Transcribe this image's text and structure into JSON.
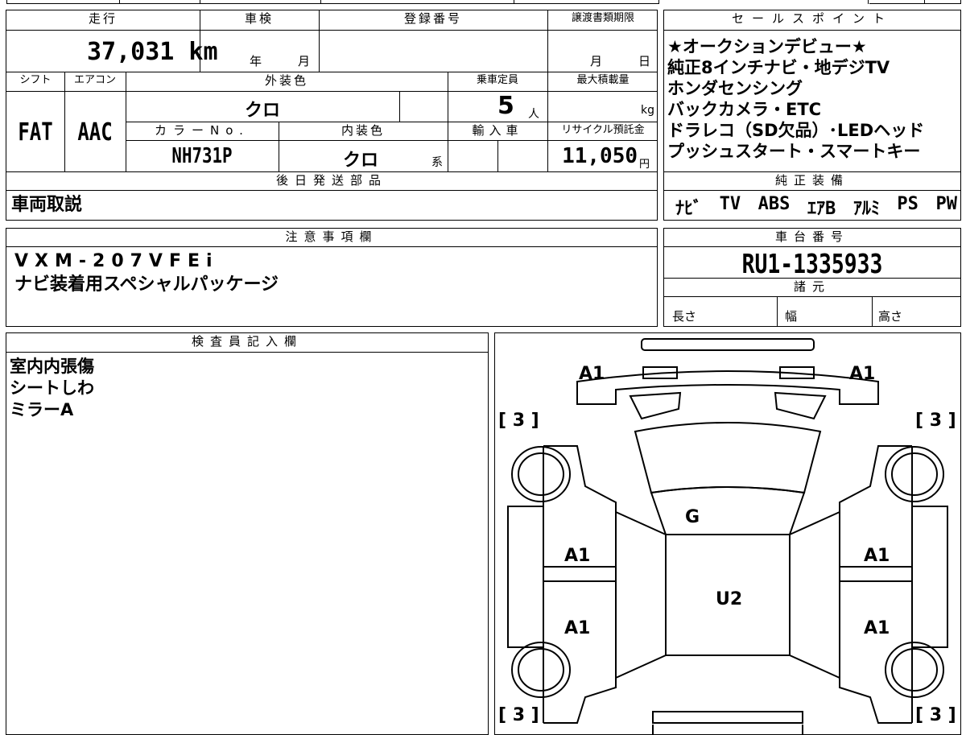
{
  "header": {
    "mileage_label": "走行",
    "inspection_label": "車検",
    "registration_label": "登録番号",
    "transfer_deadline_label": "譲渡書類期限",
    "sales_points_label": "セールスポイント"
  },
  "vehicle": {
    "mileage": "37,031 km",
    "inspection_year_unit": "年",
    "inspection_month_unit": "月",
    "transfer_month_unit": "月",
    "transfer_day_unit": "日",
    "shift_label": "シフト",
    "aircon_label": "エアコン",
    "exterior_color_label": "外装色",
    "capacity_label": "乗車定員",
    "max_load_label": "最大積載量",
    "shift": "FAT",
    "aircon": "AAC",
    "exterior_color": "クロ",
    "capacity": "5",
    "capacity_unit": "人",
    "max_load_unit": "kg",
    "color_no_label": "カラーNo.",
    "interior_color_label": "内装色",
    "import_label": "輸入車",
    "recycle_label": "リサイクル預託金",
    "color_no": "NH731P",
    "interior_color": "クロ",
    "interior_color_suffix": "系",
    "recycle_fee": "11,050",
    "recycle_unit": "円"
  },
  "sales_points": [
    "★オークションデビュー★",
    "純正8インチナビ・地デジTV",
    "ホンダセンシング",
    "バックカメラ・ETC",
    "ドラレコ（SD欠品）･LEDヘッド",
    "プッシュスタート・スマートキー"
  ],
  "shipping": {
    "label": "後日発送部品",
    "value": "車両取説"
  },
  "equipment": {
    "label": "純正装備",
    "items": [
      "ﾅﾋﾞ",
      "TV",
      "ABS",
      "ｴｱB",
      "ｱﾙﾐ",
      "PS",
      "PW"
    ]
  },
  "notes": {
    "label": "注意事項欄",
    "line1": "VXM-207VFEi",
    "line2": "ナビ装着用スペシャルパッケージ"
  },
  "chassis": {
    "label": "車台番号",
    "number": "RU1-1335933",
    "specs_label": "諸元",
    "length_label": "長さ",
    "width_label": "幅",
    "height_label": "高さ"
  },
  "inspector": {
    "label": "検査員記入欄",
    "lines": [
      "室内内張傷",
      "シートしわ",
      "ミラーA"
    ]
  },
  "diagram": {
    "marks": {
      "front_left_corner": "A1",
      "front_right_corner": "A1",
      "hood": "G",
      "roof": "U2",
      "left_front_door": "A1",
      "left_rear_door": "A1",
      "right_front_door": "A1",
      "right_rear_door": "A1",
      "tire_front_left": "[ 3 ]",
      "tire_front_right": "[ 3 ]",
      "tire_rear_left": "[ 3 ]",
      "tire_rear_right": "[ 3 ]"
    }
  }
}
